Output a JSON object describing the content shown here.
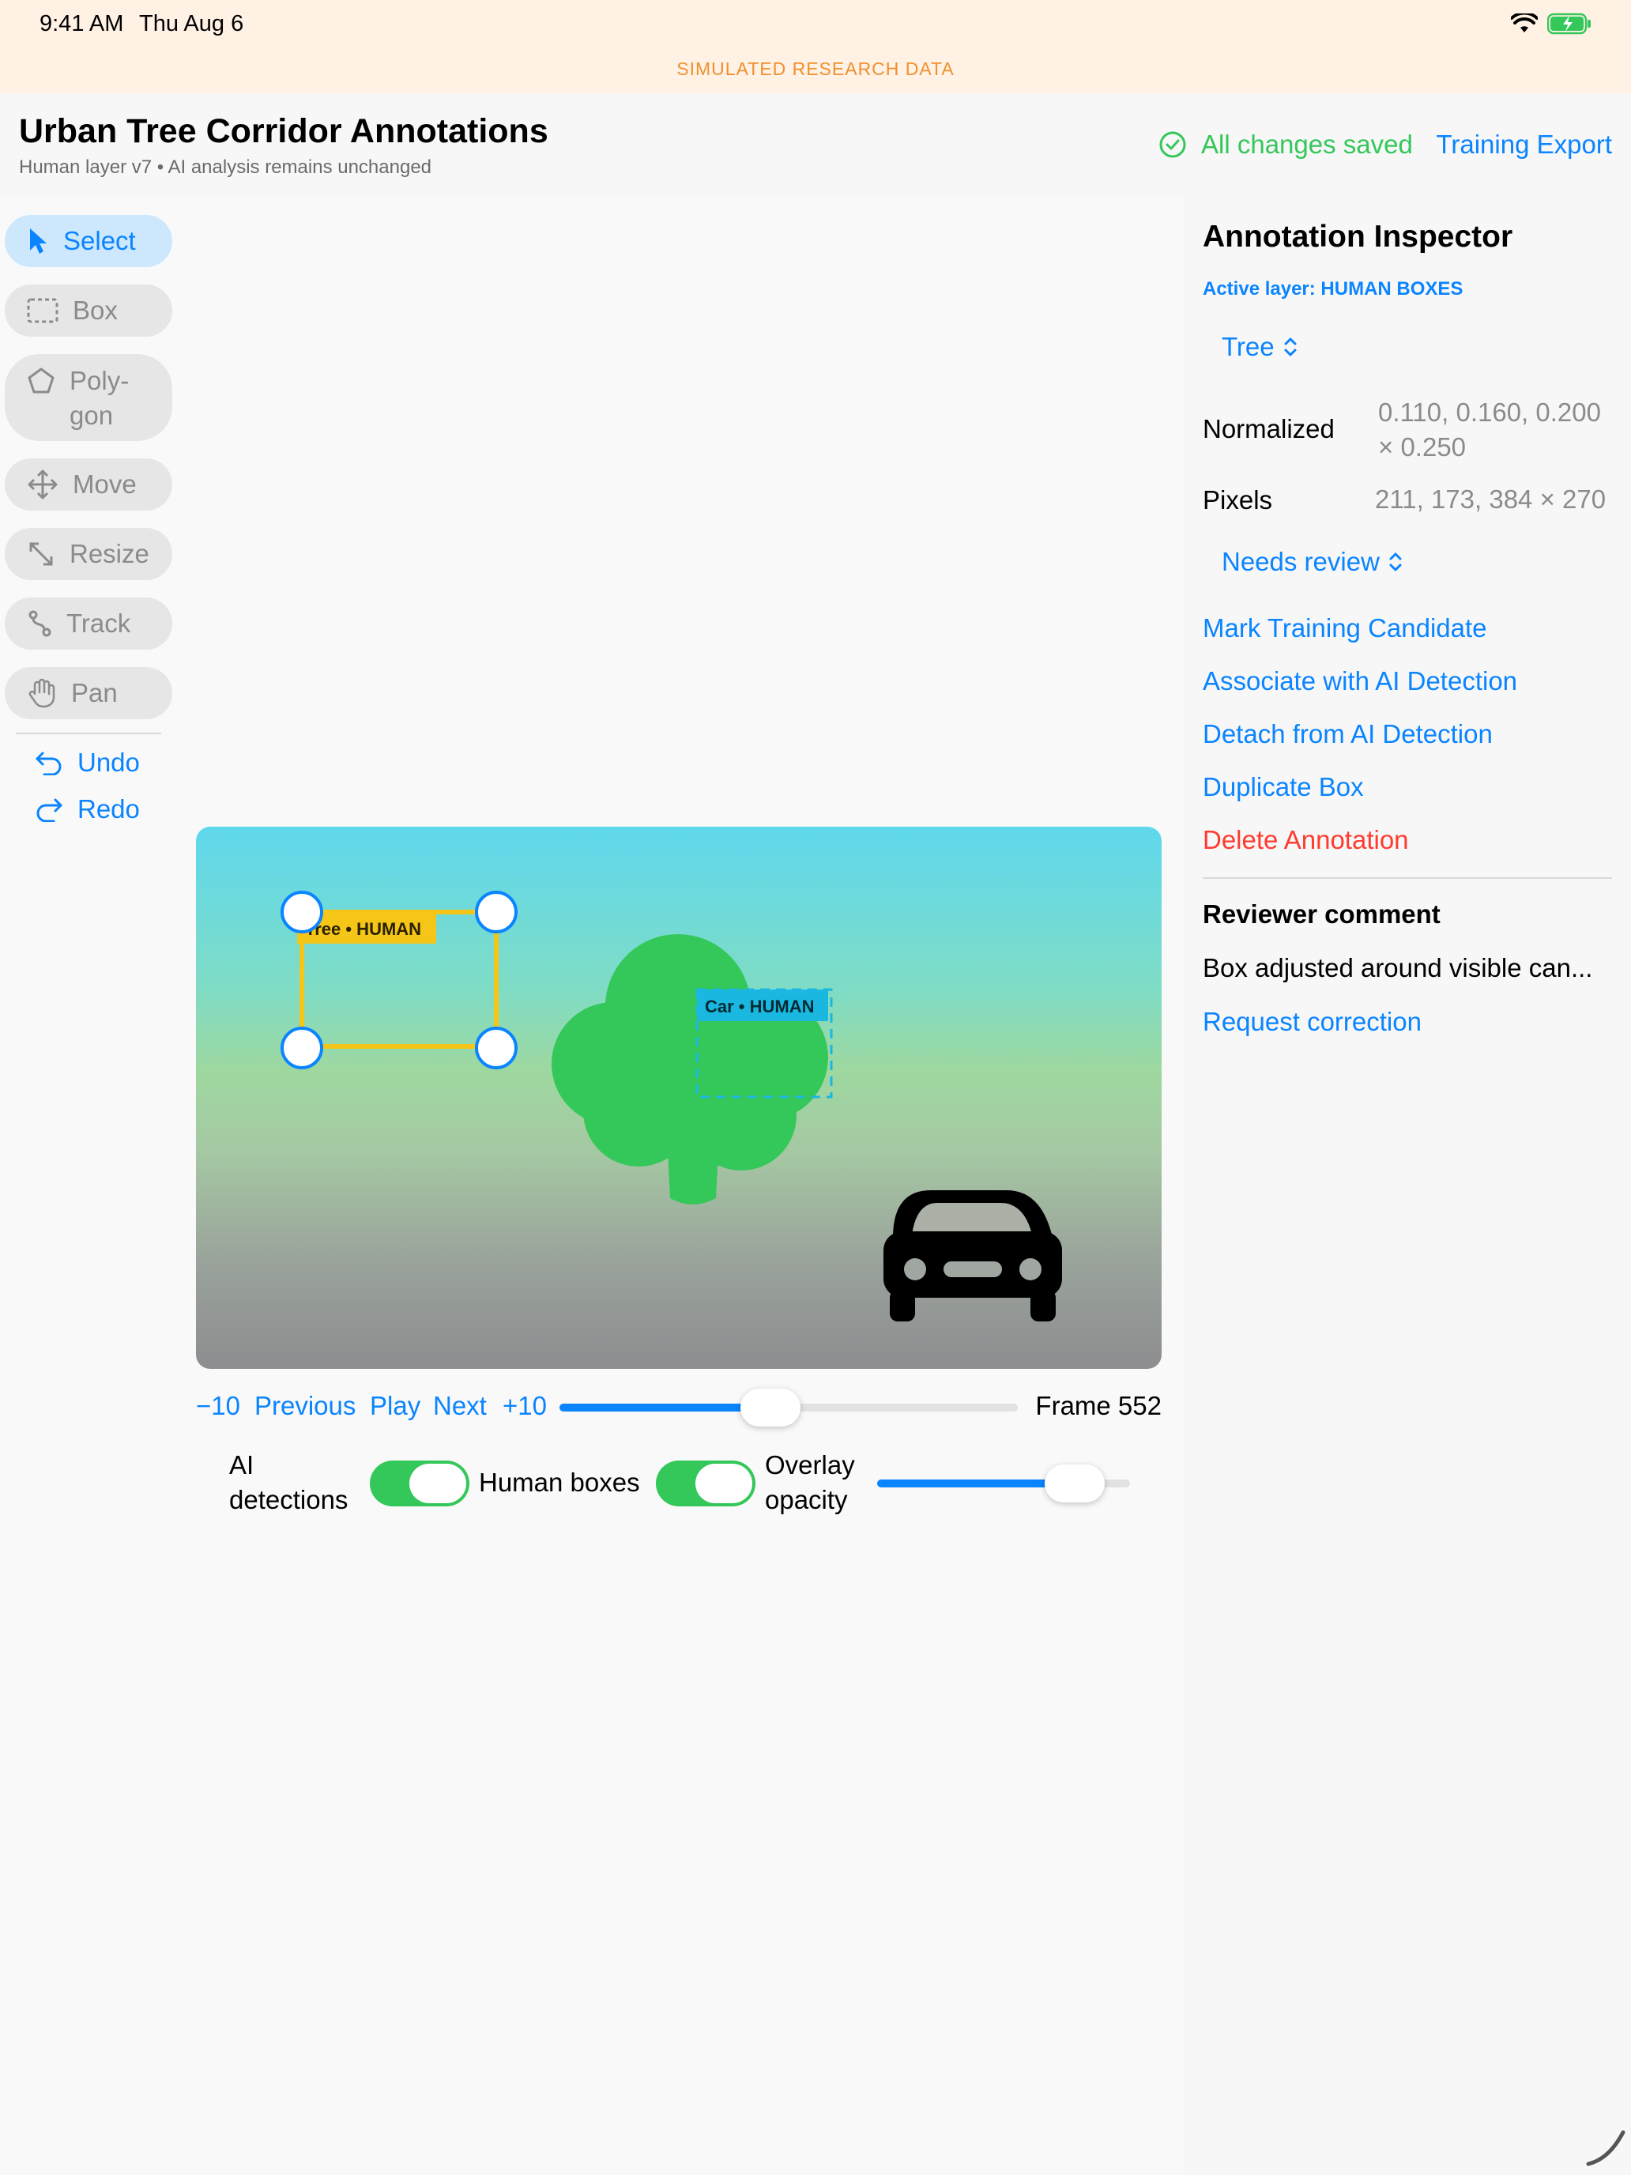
{
  "status": {
    "time": "9:41 AM",
    "date": "Thu Aug 6"
  },
  "banner": "SIMULATED RESEARCH DATA",
  "header": {
    "title": "Urban Tree Corridor Annotations",
    "subtitle": "Human layer v7 • AI analysis remains unchanged",
    "saved_label": "All changes saved",
    "export_label": "Training Export"
  },
  "tools": [
    {
      "label": "Select",
      "icon": "cursor-arrow-icon"
    },
    {
      "label": "Box",
      "icon": "dashed-rectangle-icon"
    },
    {
      "label": "Poly-\ngon",
      "icon": "pentagon-icon"
    },
    {
      "label": "Move",
      "icon": "move-arrows-icon"
    },
    {
      "label": "Resize",
      "icon": "resize-diagonal-icon"
    },
    {
      "label": "Track",
      "icon": "track-path-icon"
    },
    {
      "label": "Pan",
      "icon": "hand-icon"
    }
  ],
  "history": {
    "undo": "Undo",
    "redo": "Redo"
  },
  "canvas": {
    "tree_box_label": "Tree • HUMAN",
    "car_box_label": "Car • HUMAN",
    "colors": {
      "tree_box": "#f5c518",
      "car_box": "#1ab8e0",
      "handle": "#0a84ff",
      "tree": "#34c759",
      "car": "#000000"
    }
  },
  "playback": {
    "back10": "−10",
    "previous": "Previous",
    "play": "Play",
    "next": "Next",
    "forward10": "+10",
    "frame_label": "Frame 552",
    "scrubber_fraction": 0.46
  },
  "layers": {
    "ai_label": "AI\ndetections",
    "ai_on": true,
    "human_label": "Human boxes",
    "human_on": true,
    "opacity_label": "Overlay\nopacity",
    "opacity_fraction": 0.78
  },
  "inspector": {
    "title": "Annotation Inspector",
    "active_layer": "Active layer: HUMAN BOXES",
    "class_picker": "Tree",
    "normalized_label": "Normalized",
    "normalized_value": "0.110, 0.160, 0.200\n× 0.250",
    "pixels_label": "Pixels",
    "pixels_value": "211, 173, 384 × 270",
    "review_picker": "Needs review",
    "actions": {
      "mark": "Mark Training Candidate",
      "associate": "Associate with AI Detection",
      "detach": "Detach from AI Detection",
      "duplicate": "Duplicate Box",
      "delete": "Delete Annotation"
    },
    "comment_title": "Reviewer comment",
    "comment_text": "Box adjusted around visible can...",
    "request_correction": "Request correction"
  }
}
